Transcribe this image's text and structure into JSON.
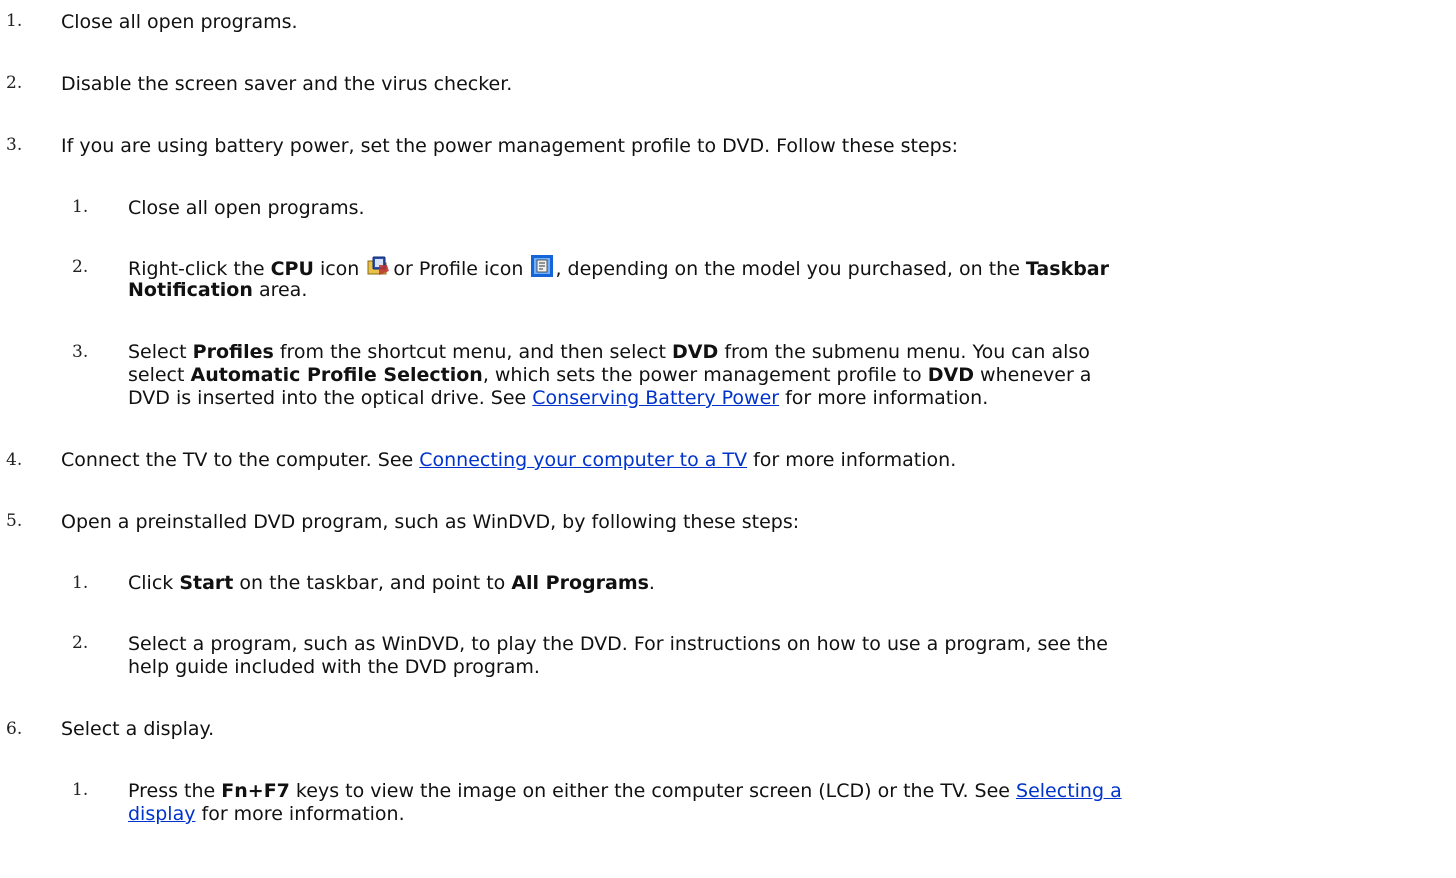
{
  "steps": [
    {
      "num": "1.",
      "text": "Close all open programs."
    },
    {
      "num": "2.",
      "text": "Disable the screen saver and the virus checker."
    },
    {
      "num": "3.",
      "text": "If you are using battery power, set the power management profile to DVD. Follow these steps:",
      "substeps": [
        {
          "num": "1.",
          "text": "Close all open programs."
        },
        {
          "num": "2.",
          "p1": "Right-click the ",
          "b1": "CPU",
          "p2": " icon",
          "p3": "or Profile icon",
          "p4": ", depending on the model you purchased, on the ",
          "b2": "Taskbar",
          "b3": "Notification",
          "p5": " area."
        },
        {
          "num": "3.",
          "line1": {
            "p1": "Select ",
            "b1": "Profiles",
            "p2": " from the shortcut menu, and then select ",
            "b2": "DVD",
            "p3": " from the submenu menu. You can also"
          },
          "line2": {
            "p1": "select ",
            "b1": "Automatic Profile Selection",
            "p2": ", which sets the power management profile to ",
            "b2": "DVD",
            "p3": " whenever a"
          },
          "line3": {
            "p1": "DVD is inserted into the optical drive. See ",
            "link": "Conserving Battery Power",
            "p2": " for more information."
          }
        }
      ]
    },
    {
      "num": "4.",
      "p1": "Connect the TV to the computer. See ",
      "link": "Connecting your computer to a TV",
      "p2": " for more information."
    },
    {
      "num": "5.",
      "text": "Open a preinstalled DVD program, such as WinDVD, by following these steps:",
      "substeps": [
        {
          "num": "1.",
          "p1": "Click ",
          "b1": "Start",
          "p2": " on the taskbar, and point to ",
          "b2": "All Programs",
          "p3": "."
        },
        {
          "num": "2.",
          "line1": "Select a program, such as WinDVD, to play the DVD. For instructions on how to use a program, see the",
          "line2": "help guide included with the DVD program."
        }
      ]
    },
    {
      "num": "6.",
      "text": "Select a display.",
      "substeps": [
        {
          "num": "1.",
          "p1": "Press the ",
          "b1": "Fn+F7",
          "p2": " keys to view the image on either the computer screen (LCD) or the TV. See ",
          "link_a": "Selecting a",
          "link_b": "display",
          "p3": " for more information."
        }
      ]
    }
  ],
  "icons": {
    "cpu": "cpu-icon",
    "profile": "profile-icon"
  }
}
